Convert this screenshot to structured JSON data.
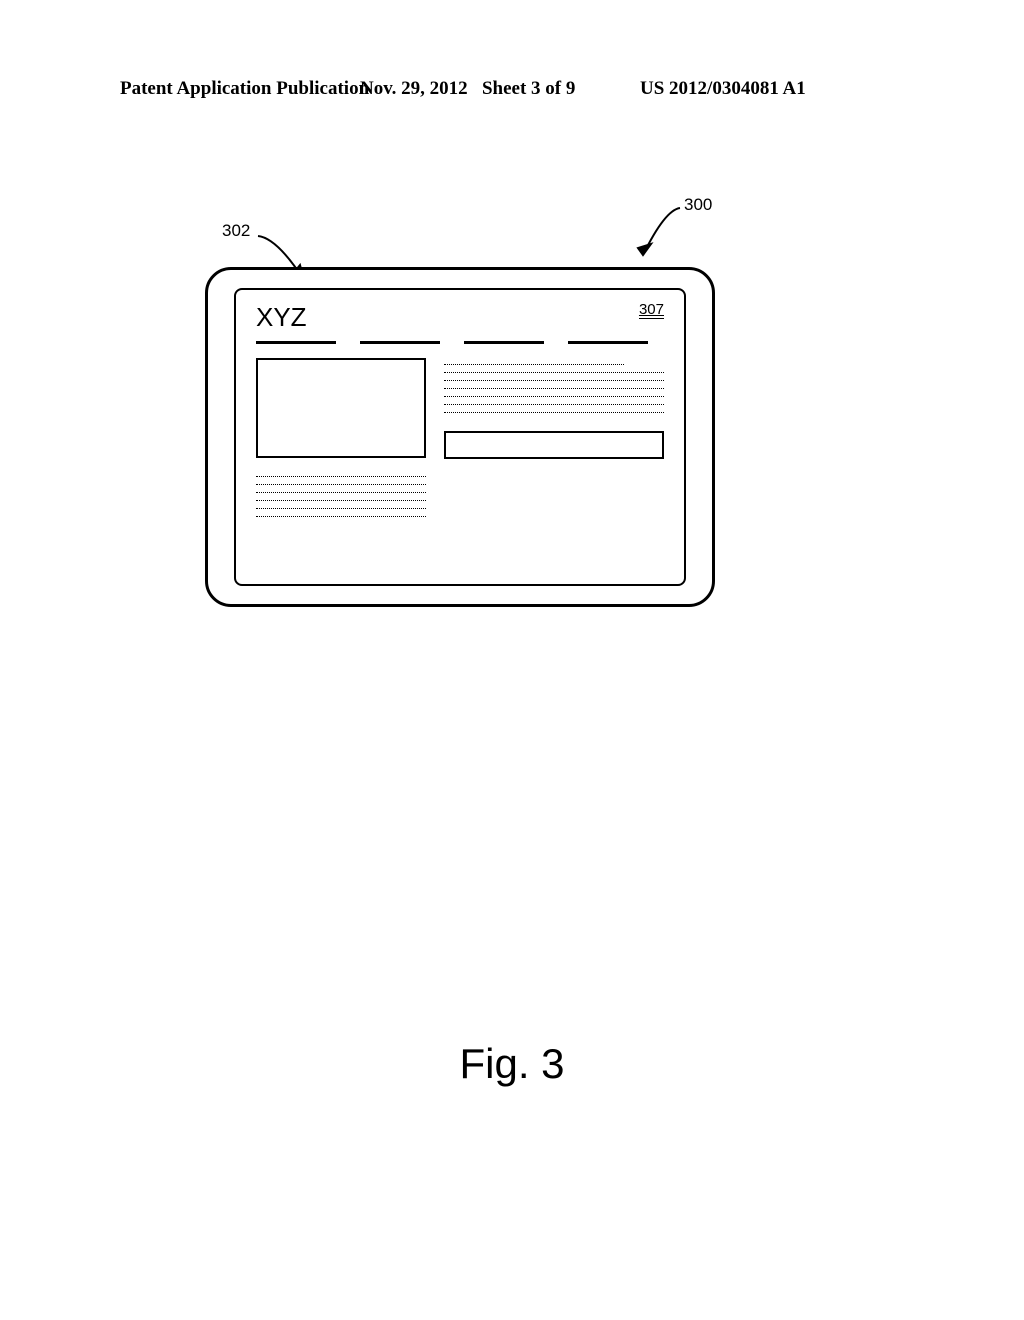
{
  "header": {
    "left": "Patent Application Publication",
    "mid_date": "Nov. 29, 2012",
    "mid_sheet": "Sheet 3 of 9",
    "right": "US 2012/0304081 A1"
  },
  "labels": {
    "ref_300": "300",
    "ref_302": "302",
    "ref_307": "307"
  },
  "site": {
    "title": "XYZ"
  },
  "figure_caption": "Fig. 3"
}
